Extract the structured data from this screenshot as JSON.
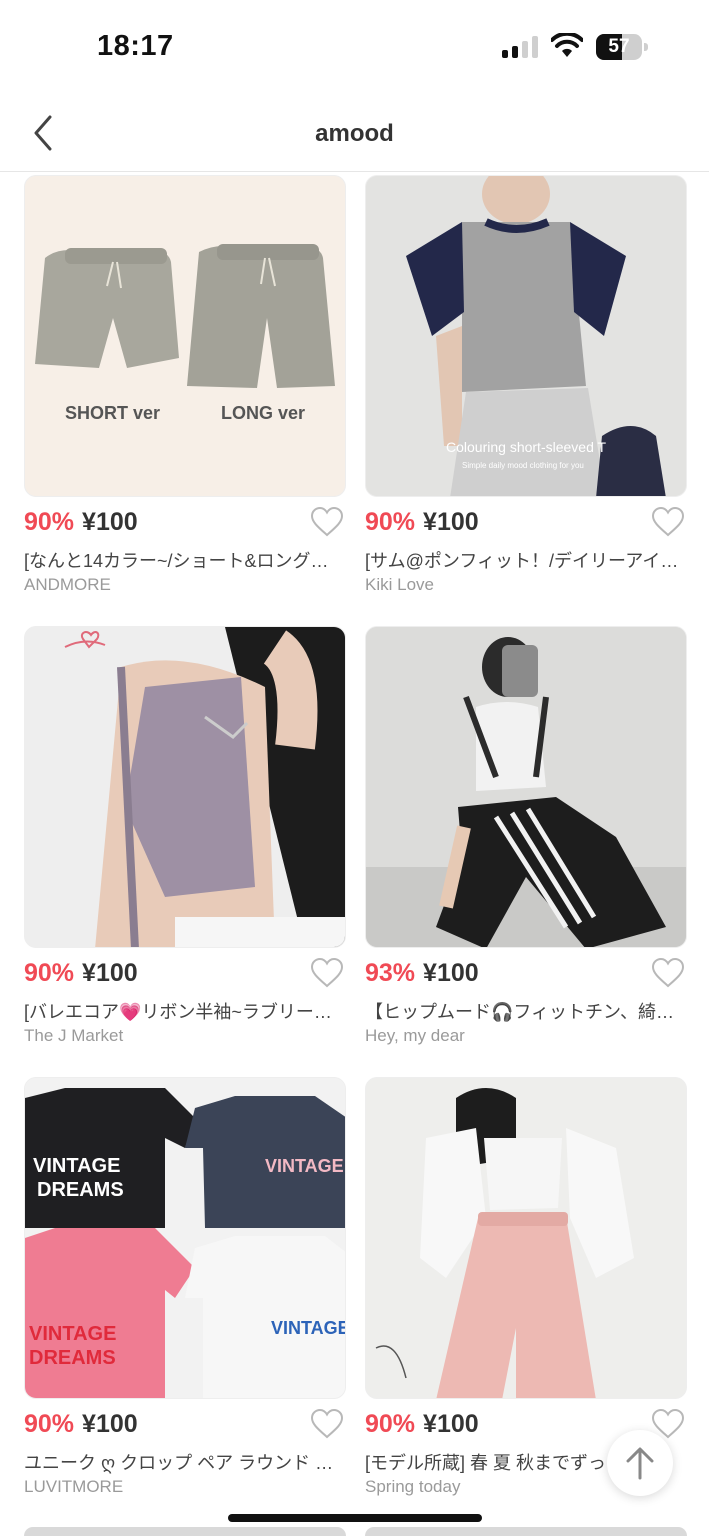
{
  "status": {
    "time": "18:17",
    "battery": "57",
    "battery_level": 0.57
  },
  "nav": {
    "title": "amood"
  },
  "products": [
    {
      "discount": "90%",
      "price": "¥100",
      "name": "[なんと14カラー~/ショート&ロング…",
      "shop": "ANDMORE",
      "image_text": [
        "SHORT ver",
        "LONG ver"
      ]
    },
    {
      "discount": "90%",
      "price": "¥100",
      "name": "[サム@ポンフィット！/デイリーアイ…",
      "shop": "Kiki Love",
      "image_text": [
        "Colouring short-sleeved T",
        "Simple daily mood clothing for you"
      ]
    },
    {
      "discount": "90%",
      "price": "¥100",
      "name": "[バレエコア💗リボン半袖~ラブリー…",
      "shop": "The J Market"
    },
    {
      "discount": "93%",
      "price": "¥100",
      "name": "【ヒップムード🎧フィットチン、綺…",
      "shop": "Hey, my dear"
    },
    {
      "discount": "90%",
      "price": "¥100",
      "name": "ユニーク ღ クロップ ペア ラウンド …",
      "shop": "LUVITMORE",
      "image_text": [
        "VINTAGE",
        "DREAMS"
      ]
    },
    {
      "discount": "90%",
      "price": "¥100",
      "name": "[モデル所蔵] 春 夏 秋までずっ…",
      "shop": "Spring today"
    }
  ]
}
